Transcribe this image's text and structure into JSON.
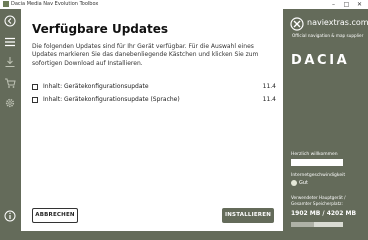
{
  "window": {
    "title": "Dacia Media Nav Evolution Toolbox",
    "minimize": "–",
    "maximize": "□",
    "close": "✕"
  },
  "rail": {
    "icons": [
      "back-icon",
      "menu-icon",
      "download-icon",
      "cart-icon",
      "settings-icon",
      "info-icon"
    ]
  },
  "main": {
    "title": "Verfügbare Updates",
    "description": "Die folgenden Updates sind für Ihr Gerät verfügbar. Für die Auswahl eines Updates markieren Sie das danebenliegende Kästchen und klicken Sie zum sofortigen Download auf Installieren.",
    "updates": [
      {
        "label": "Inhalt: Gerätekonfigurationsupdate",
        "version": "11.4",
        "checked": false
      },
      {
        "label": "Inhalt: Gerätekonfigurationsupdate (Sprache)",
        "version": "11.4",
        "checked": false
      }
    ],
    "cancel_label": "ABBRECHEN",
    "install_label": "INSTALLIEREN"
  },
  "sidebar": {
    "brand_name": "naviextras.com",
    "brand_tagline": "Official navigation & map supplier",
    "car_brand": "DACIA",
    "welcome": "Herzlich willkommen",
    "speed_label": "Internetgeschwindigkeit",
    "speed_value": "Gut",
    "storage_label": "Verwendeter Hauptgerät / Gesamter Speicherplatz:",
    "storage_value": "1902 MB / 4202 MB",
    "storage_fraction": 0.45
  },
  "colors": {
    "background": "#646b5a",
    "panel": "#ffffff"
  }
}
